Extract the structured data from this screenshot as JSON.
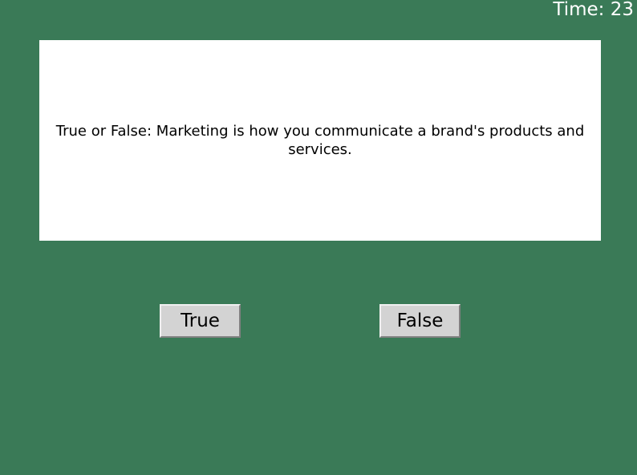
{
  "timer": {
    "label": "Time: 23"
  },
  "question": {
    "text": "True or False: Marketing is how you communicate a brand's products and services."
  },
  "answers": {
    "true_label": "True",
    "false_label": "False"
  },
  "colors": {
    "background": "#3a7a57",
    "panel": "#ffffff",
    "button": "#d3d3d3"
  }
}
